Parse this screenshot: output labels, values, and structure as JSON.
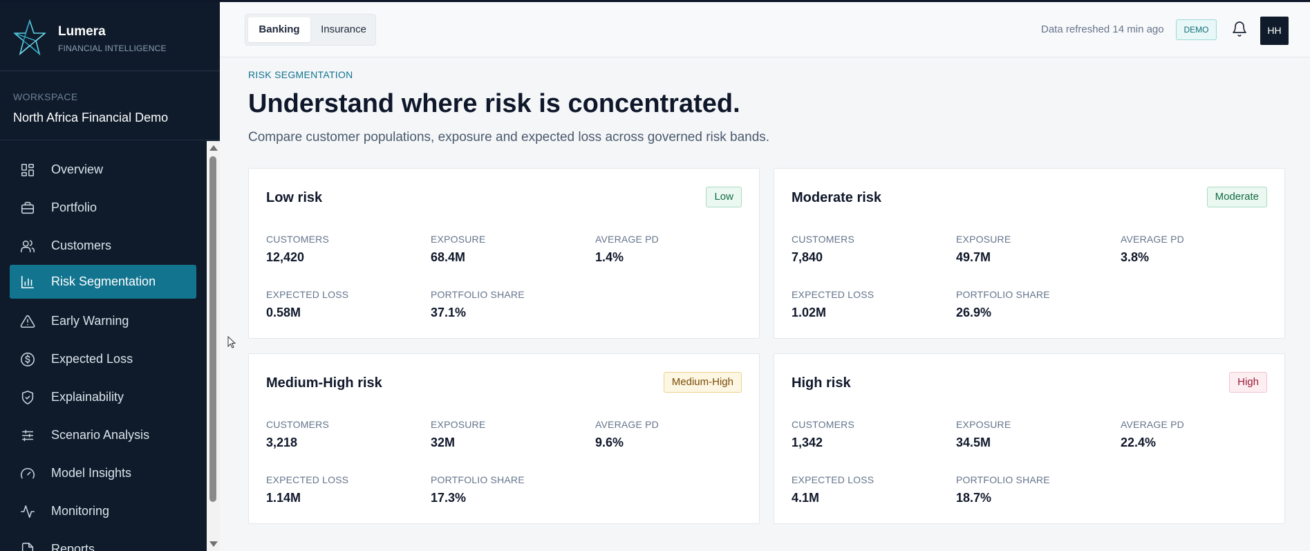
{
  "brand": {
    "name": "Lumera",
    "tagline": "FINANCIAL INTELLIGENCE"
  },
  "workspace": {
    "label": "WORKSPACE",
    "name": "North Africa Financial Demo"
  },
  "nav": {
    "items": [
      {
        "label": "Overview",
        "icon": "grid-icon"
      },
      {
        "label": "Portfolio",
        "icon": "briefcase-icon"
      },
      {
        "label": "Customers",
        "icon": "users-icon"
      },
      {
        "label": "Risk Segmentation",
        "icon": "bar-chart-icon",
        "active": true
      },
      {
        "label": "Early Warning",
        "icon": "warning-triangle-icon"
      },
      {
        "label": "Expected Loss",
        "icon": "dollar-circle-icon"
      },
      {
        "label": "Explainability",
        "icon": "shield-check-icon"
      },
      {
        "label": "Scenario Analysis",
        "icon": "sliders-icon"
      },
      {
        "label": "Model Insights",
        "icon": "gauge-icon"
      },
      {
        "label": "Monitoring",
        "icon": "activity-icon"
      },
      {
        "label": "Reports",
        "icon": "document-icon"
      }
    ]
  },
  "header": {
    "tabs": [
      {
        "label": "Banking",
        "selected": true
      },
      {
        "label": "Insurance",
        "selected": false
      }
    ],
    "refresh_text": "Data refreshed 14 min ago",
    "mode_badge": "DEMO",
    "avatar_initials": "HH"
  },
  "page": {
    "eyebrow": "RISK SEGMENTATION",
    "title": "Understand where risk is concentrated.",
    "subtitle": "Compare customer populations, exposure and expected loss across governed risk bands."
  },
  "metric_labels": {
    "customers": "CUSTOMERS",
    "exposure": "EXPOSURE",
    "average_pd": "AVERAGE PD",
    "expected_loss": "EXPECTED LOSS",
    "portfolio_share": "PORTFOLIO SHARE"
  },
  "segments": [
    {
      "title": "Low risk",
      "badge": "Low",
      "customers": "12,420",
      "exposure": "68.4M",
      "average_pd": "1.4%",
      "expected_loss": "0.58M",
      "portfolio_share": "37.1%"
    },
    {
      "title": "Moderate risk",
      "badge": "Moderate",
      "customers": "7,840",
      "exposure": "49.7M",
      "average_pd": "3.8%",
      "expected_loss": "1.02M",
      "portfolio_share": "26.9%"
    },
    {
      "title": "Medium-High risk",
      "badge": "Medium-High",
      "customers": "3,218",
      "exposure": "32M",
      "average_pd": "9.6%",
      "expected_loss": "1.14M",
      "portfolio_share": "17.3%"
    },
    {
      "title": "High risk",
      "badge": "High",
      "customers": "1,342",
      "exposure": "34.5M",
      "average_pd": "22.4%",
      "expected_loss": "4.1M",
      "portfolio_share": "18.7%"
    }
  ],
  "colors": {
    "sidebar_bg": "#0f1b2a",
    "accent": "#12748f",
    "low": "#146c43",
    "medium_high": "#7a4d06",
    "high": "#9b1c3a"
  }
}
